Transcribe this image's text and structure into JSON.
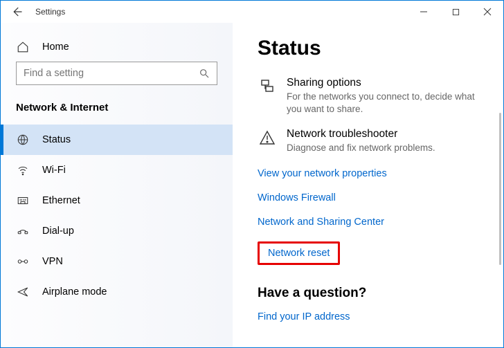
{
  "window": {
    "title": "Settings"
  },
  "home_label": "Home",
  "search_placeholder": "Find a setting",
  "category": "Network & Internet",
  "nav": [
    {
      "label": "Status",
      "selected": true
    },
    {
      "label": "Wi-Fi",
      "selected": false
    },
    {
      "label": "Ethernet",
      "selected": false
    },
    {
      "label": "Dial-up",
      "selected": false
    },
    {
      "label": "VPN",
      "selected": false
    },
    {
      "label": "Airplane mode",
      "selected": false
    }
  ],
  "page_title": "Status",
  "block_sharing": {
    "title": "Sharing options",
    "desc": "For the networks you connect to, decide what you want to share."
  },
  "block_trouble": {
    "title": "Network troubleshooter",
    "desc": "Diagnose and fix network problems."
  },
  "links": {
    "view_props": "View your network properties",
    "firewall": "Windows Firewall",
    "sharing_center": "Network and Sharing Center",
    "reset": "Network reset"
  },
  "question_heading": "Have a question?",
  "find_ip": "Find your IP address"
}
